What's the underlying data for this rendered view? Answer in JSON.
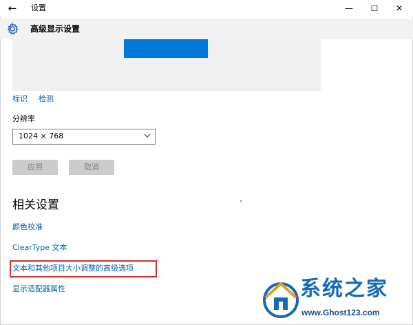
{
  "window": {
    "back_glyph": "←",
    "title": "设置",
    "minimize_glyph": "—",
    "maximize_glyph": "☐",
    "close_glyph": "✕"
  },
  "header": {
    "icon": "gear-icon",
    "title": "高级显示设置"
  },
  "display": {
    "identify_label": "标识",
    "detect_label": "检测",
    "accent_color": "#0078d7"
  },
  "resolution": {
    "label": "分辨率",
    "selected": "1024 × 768"
  },
  "buttons": {
    "apply": "应用",
    "cancel": "取消"
  },
  "related": {
    "title": "相关设置",
    "links": [
      "颜色校准",
      "ClearType 文本",
      "文本和其他项目大小调整的高级选项",
      "显示适配器属性"
    ],
    "highlight_color": "#d03030"
  },
  "watermark": {
    "title": "系统之家",
    "url": "www.Ghost123.com"
  }
}
